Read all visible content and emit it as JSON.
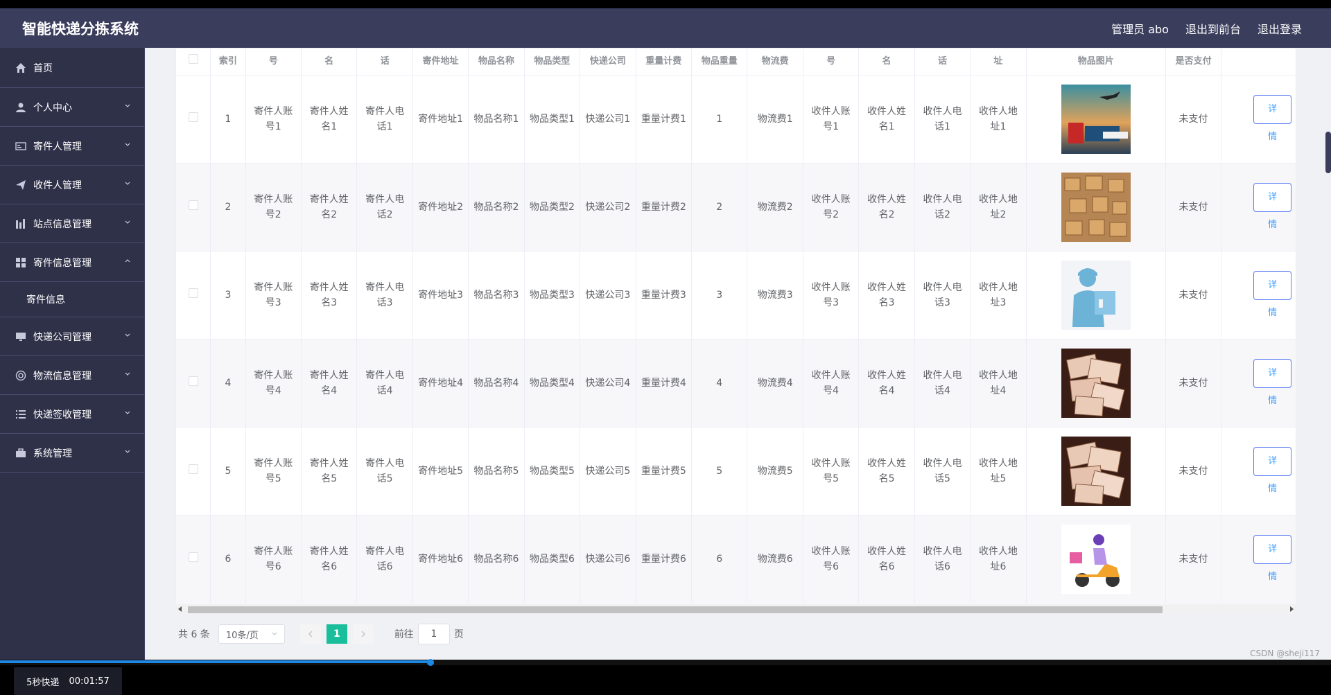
{
  "header": {
    "brand": "智能快递分拣系统",
    "user": "管理员 abo",
    "to_front": "退出到前台",
    "logout": "退出登录"
  },
  "sidebar": {
    "items": [
      {
        "label": "首页",
        "icon": "home-icon"
      },
      {
        "label": "个人中心",
        "icon": "user-icon"
      },
      {
        "label": "寄件人管理",
        "icon": "id-card-icon"
      },
      {
        "label": "收件人管理",
        "icon": "paper-plane-icon"
      },
      {
        "label": "站点信息管理",
        "icon": "bar-chart-icon"
      },
      {
        "label": "寄件信息管理",
        "icon": "grid-icon"
      },
      {
        "label": "快递公司管理",
        "icon": "monitor-icon"
      },
      {
        "label": "物流信息管理",
        "icon": "circle-icon"
      },
      {
        "label": "快递签收管理",
        "icon": "list-icon"
      },
      {
        "label": "系统管理",
        "icon": "briefcase-icon"
      }
    ],
    "submenu_label": "寄件信息",
    "timer_label": "5秒快递",
    "timer_time": "00:01:57"
  },
  "table": {
    "headers": [
      "索引",
      "号",
      "名",
      "话",
      "寄件地址",
      "物品名称",
      "物品类型",
      "快递公司",
      "重量计费",
      "物品重量",
      "物流费",
      "号",
      "名",
      "话",
      "址",
      "物品图片",
      "是否支付"
    ],
    "detail_label": "详情",
    "rows": [
      {
        "idx": "1",
        "acc": "寄件人账号1",
        "name": "寄件人姓名1",
        "tel": "寄件人电话1",
        "addr": "寄件地址1",
        "item": "物品名称1",
        "type": "物品类型1",
        "co": "快递公司1",
        "fee": "重量计费1",
        "weight": "1",
        "logi": "物流费1",
        "racc": "收件人账号1",
        "rname": "收件人姓名1",
        "rtel": "收件人电话1",
        "raddr": "收件人地址1",
        "img": "plane-truck-ship-image",
        "paid": "未支付"
      },
      {
        "idx": "2",
        "acc": "寄件人账号2",
        "name": "寄件人姓名2",
        "tel": "寄件人电话2",
        "addr": "寄件地址2",
        "item": "物品名称2",
        "type": "物品类型2",
        "co": "快递公司2",
        "fee": "重量计费2",
        "weight": "2",
        "logi": "物流费2",
        "racc": "收件人账号2",
        "rname": "收件人姓名2",
        "rtel": "收件人电话2",
        "raddr": "收件人地址2",
        "img": "cardboard-boxes-image",
        "paid": "未支付"
      },
      {
        "idx": "3",
        "acc": "寄件人账号3",
        "name": "寄件人姓名3",
        "tel": "寄件人电话3",
        "addr": "寄件地址3",
        "item": "物品名称3",
        "type": "物品类型3",
        "co": "快递公司3",
        "fee": "重量计费3",
        "weight": "3",
        "logi": "物流费3",
        "racc": "收件人账号3",
        "rname": "收件人姓名3",
        "rtel": "收件人电话3",
        "raddr": "收件人地址3",
        "img": "courier-image",
        "paid": "未支付"
      },
      {
        "idx": "4",
        "acc": "寄件人账号4",
        "name": "寄件人姓名4",
        "tel": "寄件人电话4",
        "addr": "寄件地址4",
        "item": "物品名称4",
        "type": "物品类型4",
        "co": "快递公司4",
        "fee": "重量计费4",
        "weight": "4",
        "logi": "物流费4",
        "racc": "收件人账号4",
        "rname": "收件人姓名4",
        "rtel": "收件人电话4",
        "raddr": "收件人地址4",
        "img": "envelopes-image",
        "paid": "未支付"
      },
      {
        "idx": "5",
        "acc": "寄件人账号5",
        "name": "寄件人姓名5",
        "tel": "寄件人电话5",
        "addr": "寄件地址5",
        "item": "物品名称5",
        "type": "物品类型5",
        "co": "快递公司5",
        "fee": "重量计费5",
        "weight": "5",
        "logi": "物流费5",
        "racc": "收件人账号5",
        "rname": "收件人姓名5",
        "rtel": "收件人电话5",
        "raddr": "收件人地址5",
        "img": "envelopes-image",
        "paid": "未支付"
      },
      {
        "idx": "6",
        "acc": "寄件人账号6",
        "name": "寄件人姓名6",
        "tel": "寄件人电话6",
        "addr": "寄件地址6",
        "item": "物品名称6",
        "type": "物品类型6",
        "co": "快递公司6",
        "fee": "重量计费6",
        "weight": "6",
        "logi": "物流费6",
        "racc": "收件人账号6",
        "rname": "收件人姓名6",
        "rtel": "收件人电话6",
        "raddr": "收件人地址6",
        "img": "scooter-delivery-image",
        "paid": "未支付"
      }
    ]
  },
  "pagination": {
    "total": "共 6 条",
    "page_size": "10条/页",
    "current": "1",
    "goto_prefix": "前往",
    "goto_value": "1",
    "goto_suffix": "页"
  },
  "watermark": "CSDN @sheji117",
  "colors": {
    "header_bg": "#3a3d5c",
    "sidebar_bg": "#2f3149",
    "accent": "#19be9a",
    "button_border": "#5b7cf2"
  }
}
